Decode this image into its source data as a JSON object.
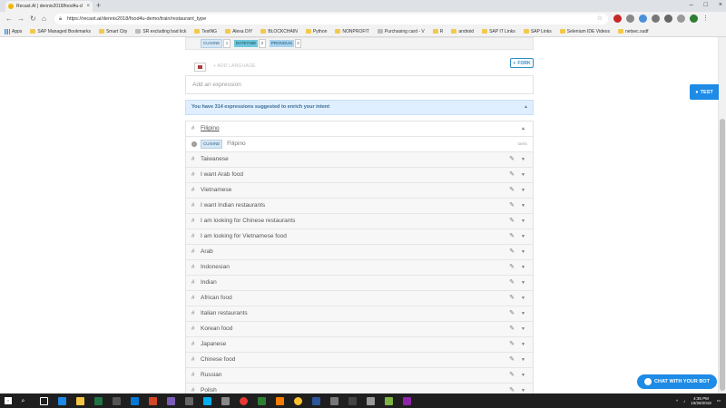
{
  "browser": {
    "tab_title": "Recast.AI | dennis2018/food4u-d",
    "tab_close": "×",
    "new_tab": "+",
    "url": "https://recast.ai/dennis2018/food4u-demo/train/restaurant_type",
    "bookmarks": [
      {
        "label": "Apps",
        "type": "apps"
      },
      {
        "label": "SAP Managed Bookmarks",
        "type": "folder"
      },
      {
        "label": "Smart City",
        "type": "folder"
      },
      {
        "label": "SR excluding bad tick",
        "type": "page"
      },
      {
        "label": "TestNG",
        "type": "folder"
      },
      {
        "label": "Alexa DIY",
        "type": "folder"
      },
      {
        "label": "BLOCKCHAIN",
        "type": "folder"
      },
      {
        "label": "Python",
        "type": "folder"
      },
      {
        "label": "NONPROFIT",
        "type": "folder"
      },
      {
        "label": "Purchasing card - V",
        "type": "page"
      },
      {
        "label": "R",
        "type": "folder"
      },
      {
        "label": "android",
        "type": "folder"
      },
      {
        "label": "SAP IT Links",
        "type": "folder"
      },
      {
        "label": "SAP Links",
        "type": "folder"
      },
      {
        "label": "Selenium IDE Videos",
        "type": "folder"
      },
      {
        "label": "netsec.sudf",
        "type": "folder"
      }
    ]
  },
  "top_expression": {
    "entities": [
      {
        "name": "CUISINE",
        "value": "1"
      },
      {
        "name": "DATETIME",
        "value": "2"
      },
      {
        "name": "PRONOUN",
        "value": "4"
      }
    ]
  },
  "language": {
    "add_label": "+ ADD LANGUAGE",
    "fork_label": "FORK"
  },
  "add_expression_placeholder": "Add an expression",
  "suggestion_banner": "You have 314 expressions suggested to enrich your intent",
  "expressions": {
    "open": {
      "text": "Filipino",
      "entity": "CUISINE",
      "entity_value": "Filipino",
      "language": "tasks"
    },
    "items": [
      "Taiwanese",
      "I want Arab food",
      "Vietnamese",
      "I want Indian restaurants",
      "I am looking for Chinese restaurants",
      "I am looking for Vietnamese food",
      "Arab",
      "Indonesian",
      "Indian",
      "African food",
      "Italian restaurants",
      "Korean food",
      "Japanese",
      "Chinese food",
      "Russian",
      "Polish"
    ]
  },
  "buttons": {
    "test_label": "TEST",
    "chat_label": "CHAT WITH YOUR BOT"
  },
  "taskbar": {
    "time": "4:35 PM",
    "date": "10/26/2018"
  }
}
